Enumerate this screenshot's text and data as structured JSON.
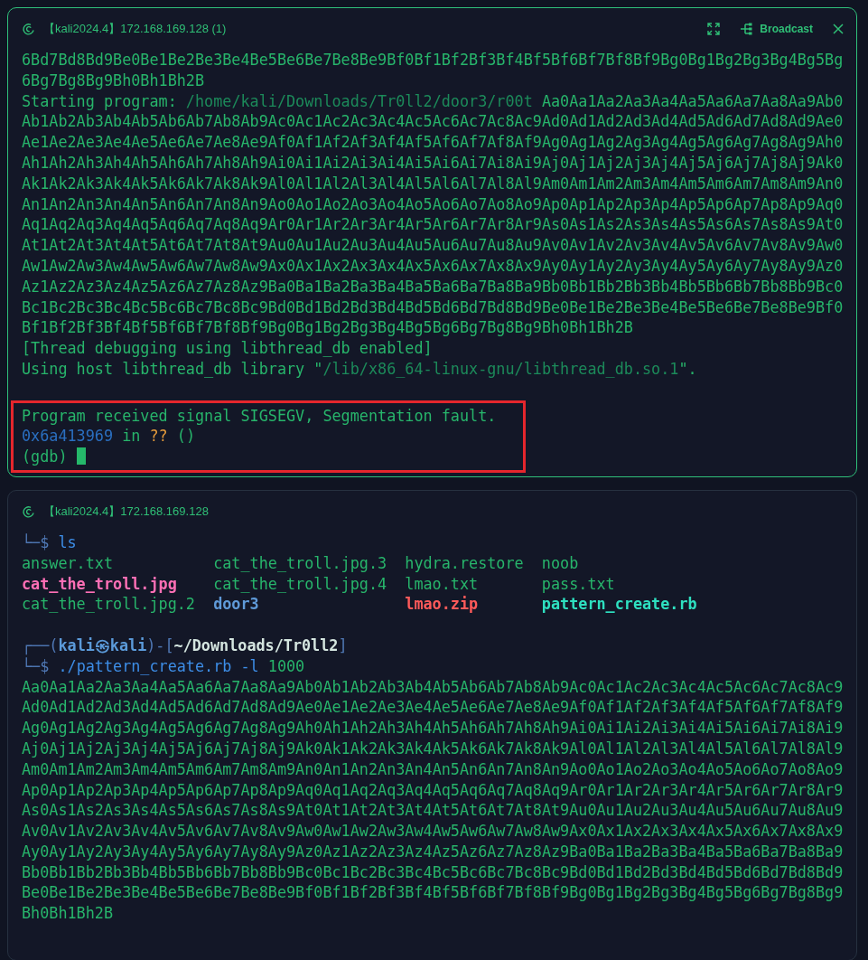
{
  "terminals": [
    {
      "title": "【kali2024.4】172.168.169.128 (1)",
      "active": true,
      "broadcast_label": "Broadcast",
      "blocks": [
        {
          "kind": "lines",
          "lines": [
            [
              {
                "text": "6Bd7Bd8Bd9Be0Be1Be2Be3Be4Be5Be6Be7Be8Be9Bf0Bf1Bf2Bf3Bf4Bf5Bf6Bf7Bf8Bf9Bg0Bg1Bg2Bg3Bg4Bg5Bg",
                "kind": "output"
              }
            ],
            [
              {
                "text": "6Bg7Bg8Bg9Bh0Bh1Bh2B",
                "kind": "output"
              }
            ],
            [
              {
                "text": "Starting program: ",
                "kind": "output"
              },
              {
                "text": "/home/kali/Downloads/Tr0ll2/door3/r00t",
                "kind": "path"
              },
              {
                "text": " Aa0Aa1Aa2Aa3Aa4Aa5Aa6Aa7Aa8Aa9Ab0",
                "kind": "output"
              }
            ],
            [
              {
                "text": "Ab1Ab2Ab3Ab4Ab5Ab6Ab7Ab8Ab9Ac0Ac1Ac2Ac3Ac4Ac5Ac6Ac7Ac8Ac9Ad0Ad1Ad2Ad3Ad4Ad5Ad6Ad7Ad8Ad9Ae0",
                "kind": "output"
              }
            ],
            [
              {
                "text": "Ae1Ae2Ae3Ae4Ae5Ae6Ae7Ae8Ae9Af0Af1Af2Af3Af4Af5Af6Af7Af8Af9Ag0Ag1Ag2Ag3Ag4Ag5Ag6Ag7Ag8Ag9Ah0",
                "kind": "output"
              }
            ],
            [
              {
                "text": "Ah1Ah2Ah3Ah4Ah5Ah6Ah7Ah8Ah9Ai0Ai1Ai2Ai3Ai4Ai5Ai6Ai7Ai8Ai9Aj0Aj1Aj2Aj3Aj4Aj5Aj6Aj7Aj8Aj9Ak0",
                "kind": "output"
              }
            ],
            [
              {
                "text": "Ak1Ak2Ak3Ak4Ak5Ak6Ak7Ak8Ak9Al0Al1Al2Al3Al4Al5Al6Al7Al8Al9Am0Am1Am2Am3Am4Am5Am6Am7Am8Am9An0",
                "kind": "output"
              }
            ],
            [
              {
                "text": "An1An2An3An4An5An6An7An8An9Ao0Ao1Ao2Ao3Ao4Ao5Ao6Ao7Ao8Ao9Ap0Ap1Ap2Ap3Ap4Ap5Ap6Ap7Ap8Ap9Aq0",
                "kind": "output"
              }
            ],
            [
              {
                "text": "Aq1Aq2Aq3Aq4Aq5Aq6Aq7Aq8Aq9Ar0Ar1Ar2Ar3Ar4Ar5Ar6Ar7Ar8Ar9As0As1As2As3As4As5As6As7As8As9At0",
                "kind": "output"
              }
            ],
            [
              {
                "text": "At1At2At3At4At5At6At7At8At9Au0Au1Au2Au3Au4Au5Au6Au7Au8Au9Av0Av1Av2Av3Av4Av5Av6Av7Av8Av9Aw0",
                "kind": "output"
              }
            ],
            [
              {
                "text": "Aw1Aw2Aw3Aw4Aw5Aw6Aw7Aw8Aw9Ax0Ax1Ax2Ax3Ax4Ax5Ax6Ax7Ax8Ax9Ay0Ay1Ay2Ay3Ay4Ay5Ay6Ay7Ay8Ay9Az0",
                "kind": "output"
              }
            ],
            [
              {
                "text": "Az1Az2Az3Az4Az5Az6Az7Az8Az9Ba0Ba1Ba2Ba3Ba4Ba5Ba6Ba7Ba8Ba9Bb0Bb1Bb2Bb3Bb4Bb5Bb6Bb7Bb8Bb9Bc0",
                "kind": "output"
              }
            ],
            [
              {
                "text": "Bc1Bc2Bc3Bc4Bc5Bc6Bc7Bc8Bc9Bd0Bd1Bd2Bd3Bd4Bd5Bd6Bd7Bd8Bd9Be0Be1Be2Be3Be4Be5Be6Be7Be8Be9Bf0",
                "kind": "output"
              }
            ],
            [
              {
                "text": "Bf1Bf2Bf3Bf4Bf5Bf6Bf7Bf8Bf9Bg0Bg1Bg2Bg3Bg4Bg5Bg6Bg7Bg8Bg9Bh0Bh1Bh2B",
                "kind": "output"
              }
            ],
            [
              {
                "text": "[Thread debugging using libthread_db enabled]",
                "kind": "output"
              }
            ],
            [
              {
                "text": "Using host libthread_db library \"",
                "kind": "output"
              },
              {
                "text": "/lib/x86_64-linux-gnu/libthread_db.so.1",
                "kind": "path"
              },
              {
                "text": "\".",
                "kind": "output"
              }
            ]
          ]
        },
        {
          "kind": "highlight",
          "cursor": true,
          "lines": [
            [
              {
                "text": "Program received signal SIGSEGV, Segmentation fault.",
                "kind": "output"
              }
            ],
            [
              {
                "text": "0x6a413969",
                "kind": "address"
              },
              {
                "text": " in ",
                "kind": "output"
              },
              {
                "text": "??",
                "kind": "unknown"
              },
              {
                "text": " ()",
                "kind": "output"
              }
            ],
            [
              {
                "text": "(gdb) ",
                "kind": "output"
              }
            ]
          ]
        }
      ]
    },
    {
      "title": "【kali2024.4】172.168.169.128",
      "active": false,
      "blocks": [
        {
          "kind": "lines",
          "lines": [
            [
              {
                "text": "└─$ ",
                "kind": "frame"
              },
              {
                "text": "ls",
                "kind": "command"
              }
            ]
          ]
        },
        {
          "kind": "listing",
          "items": [
            {
              "text": "answer.txt",
              "kind": "file"
            },
            {
              "text": "cat_the_troll.jpg.3",
              "kind": "file"
            },
            {
              "text": "hydra.restore",
              "kind": "file"
            },
            {
              "text": "noob",
              "kind": "file"
            },
            {
              "text": "cat_the_troll.jpg",
              "kind": "image"
            },
            {
              "text": "cat_the_troll.jpg.4",
              "kind": "file"
            },
            {
              "text": "lmao.txt",
              "kind": "file"
            },
            {
              "text": "pass.txt",
              "kind": "file"
            },
            {
              "text": "cat_the_troll.jpg.2",
              "kind": "file"
            },
            {
              "text": "door3",
              "kind": "dir"
            },
            {
              "text": "lmao.zip",
              "kind": "archive"
            },
            {
              "text": "pattern_create.rb",
              "kind": "script"
            }
          ]
        },
        {
          "kind": "lines",
          "lines": [
            [
              {
                "text": "┌──(",
                "kind": "frame"
              },
              {
                "text": "kali㉿kali",
                "kind": "user"
              },
              {
                "text": ")-[",
                "kind": "frame"
              },
              {
                "text": "~/Downloads/Tr0ll2",
                "kind": "cwd"
              },
              {
                "text": "]",
                "kind": "frame"
              }
            ],
            [
              {
                "text": "└─$ ",
                "kind": "frame"
              },
              {
                "text": "./pattern_create.rb",
                "kind": "command"
              },
              {
                "text": " -l",
                "kind": "command"
              },
              {
                "text": " 1000",
                "kind": "output"
              }
            ],
            [
              {
                "text": "Aa0Aa1Aa2Aa3Aa4Aa5Aa6Aa7Aa8Aa9Ab0Ab1Ab2Ab3Ab4Ab5Ab6Ab7Ab8Ab9Ac0Ac1Ac2Ac3Ac4Ac5Ac6Ac7Ac8Ac9",
                "kind": "output"
              }
            ],
            [
              {
                "text": "Ad0Ad1Ad2Ad3Ad4Ad5Ad6Ad7Ad8Ad9Ae0Ae1Ae2Ae3Ae4Ae5Ae6Ae7Ae8Ae9Af0Af1Af2Af3Af4Af5Af6Af7Af8Af9",
                "kind": "output"
              }
            ],
            [
              {
                "text": "Ag0Ag1Ag2Ag3Ag4Ag5Ag6Ag7Ag8Ag9Ah0Ah1Ah2Ah3Ah4Ah5Ah6Ah7Ah8Ah9Ai0Ai1Ai2Ai3Ai4Ai5Ai6Ai7Ai8Ai9",
                "kind": "output"
              }
            ],
            [
              {
                "text": "Aj0Aj1Aj2Aj3Aj4Aj5Aj6Aj7Aj8Aj9Ak0Ak1Ak2Ak3Ak4Ak5Ak6Ak7Ak8Ak9Al0Al1Al2Al3Al4Al5Al6Al7Al8Al9",
                "kind": "output"
              }
            ],
            [
              {
                "text": "Am0Am1Am2Am3Am4Am5Am6Am7Am8Am9An0An1An2An3An4An5An6An7An8An9Ao0Ao1Ao2Ao3Ao4Ao5Ao6Ao7Ao8Ao9",
                "kind": "output"
              }
            ],
            [
              {
                "text": "Ap0Ap1Ap2Ap3Ap4Ap5Ap6Ap7Ap8Ap9Aq0Aq1Aq2Aq3Aq4Aq5Aq6Aq7Aq8Aq9Ar0Ar1Ar2Ar3Ar4Ar5Ar6Ar7Ar8Ar9",
                "kind": "output"
              }
            ],
            [
              {
                "text": "As0As1As2As3As4As5As6As7As8As9At0At1At2At3At4At5At6At7At8At9Au0Au1Au2Au3Au4Au5Au6Au7Au8Au9",
                "kind": "output"
              }
            ],
            [
              {
                "text": "Av0Av1Av2Av3Av4Av5Av6Av7Av8Av9Aw0Aw1Aw2Aw3Aw4Aw5Aw6Aw7Aw8Aw9Ax0Ax1Ax2Ax3Ax4Ax5Ax6Ax7Ax8Ax9",
                "kind": "output"
              }
            ],
            [
              {
                "text": "Ay0Ay1Ay2Ay3Ay4Ay5Ay6Ay7Ay8Ay9Az0Az1Az2Az3Az4Az5Az6Az7Az8Az9Ba0Ba1Ba2Ba3Ba4Ba5Ba6Ba7Ba8Ba9",
                "kind": "output"
              }
            ],
            [
              {
                "text": "Bb0Bb1Bb2Bb3Bb4Bb5Bb6Bb7Bb8Bb9Bc0Bc1Bc2Bc3Bc4Bc5Bc6Bc7Bc8Bc9Bd0Bd1Bd2Bd3Bd4Bd5Bd6Bd7Bd8Bd9",
                "kind": "output"
              }
            ],
            [
              {
                "text": "Be0Be1Be2Be3Be4Be5Be6Be7Be8Be9Bf0Bf1Bf2Bf3Bf4Bf5Bf6Bf7Bf8Bf9Bg0Bg1Bg2Bg3Bg4Bg5Bg6Bg7Bg8Bg9",
                "kind": "output"
              }
            ],
            [
              {
                "text": "Bh0Bh1Bh2B",
                "kind": "output"
              }
            ]
          ]
        }
      ]
    }
  ]
}
